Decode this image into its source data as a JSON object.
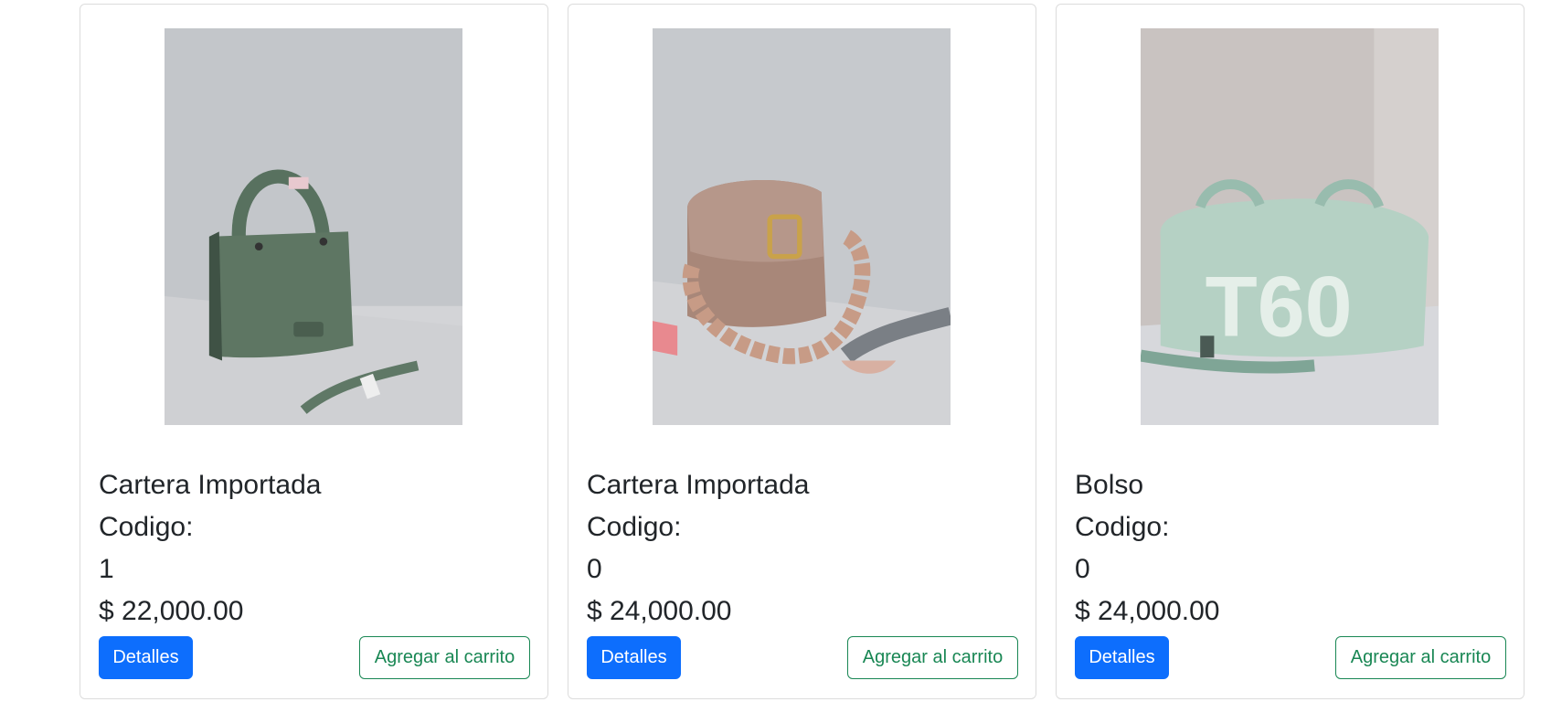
{
  "products": [
    {
      "name": "Cartera Importada",
      "code_label": "Codigo:",
      "code": "1",
      "price": "$ 22,000.00",
      "details_label": "Detalles",
      "cart_label": "Agregar al carrito",
      "image": "green-handbag"
    },
    {
      "name": "Cartera Importada",
      "code_label": "Codigo:",
      "code": "0",
      "price": "$ 24,000.00",
      "details_label": "Detalles",
      "cart_label": "Agregar al carrito",
      "image": "pink-crossbody-bag"
    },
    {
      "name": "Bolso",
      "code_label": "Codigo:",
      "code": "0",
      "price": "$ 24,000.00",
      "details_label": "Detalles",
      "cart_label": "Agregar al carrito",
      "image": "mint-duffel-bag",
      "image_text": "T60"
    }
  ],
  "colors": {
    "primary": "#0d6efd",
    "success": "#198754",
    "text": "#212529",
    "border": "#dcdcdc"
  }
}
